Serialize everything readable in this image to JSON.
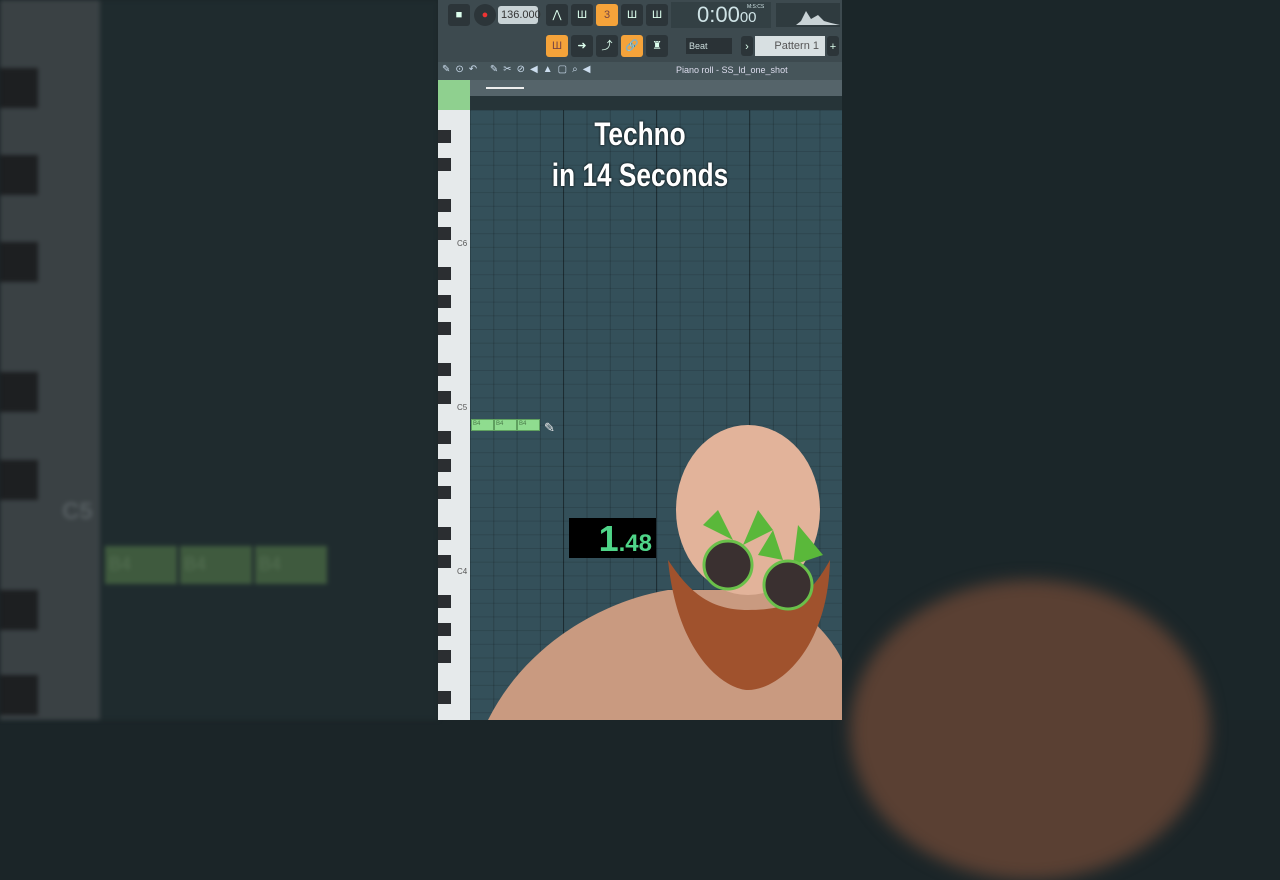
{
  "overlay": {
    "title_line1": "Techno",
    "title_line2": "in 14 Seconds",
    "timer_main": "1",
    "timer_decimal": ".48"
  },
  "toolbar": {
    "tempo": "136.000",
    "time": "0:00",
    "time_cs": "00",
    "time_label": "M:S:CS",
    "snap": "Beat",
    "pattern": "Pattern 1",
    "pattern_add": "+",
    "piano_roll_title": "Piano roll - SS_ld_one_shot"
  },
  "keys": {
    "c6": "C6",
    "c5": "C5",
    "c4": "C4"
  },
  "notes": [
    {
      "label": "B4"
    },
    {
      "label": "B4"
    },
    {
      "label": "B4"
    }
  ],
  "background": {
    "c5": "C5",
    "notes": [
      "B4",
      "B4",
      "B4"
    ]
  },
  "colors": {
    "accent": "#f5a33a",
    "note": "#8fdc8f",
    "grid": "#34505a"
  }
}
